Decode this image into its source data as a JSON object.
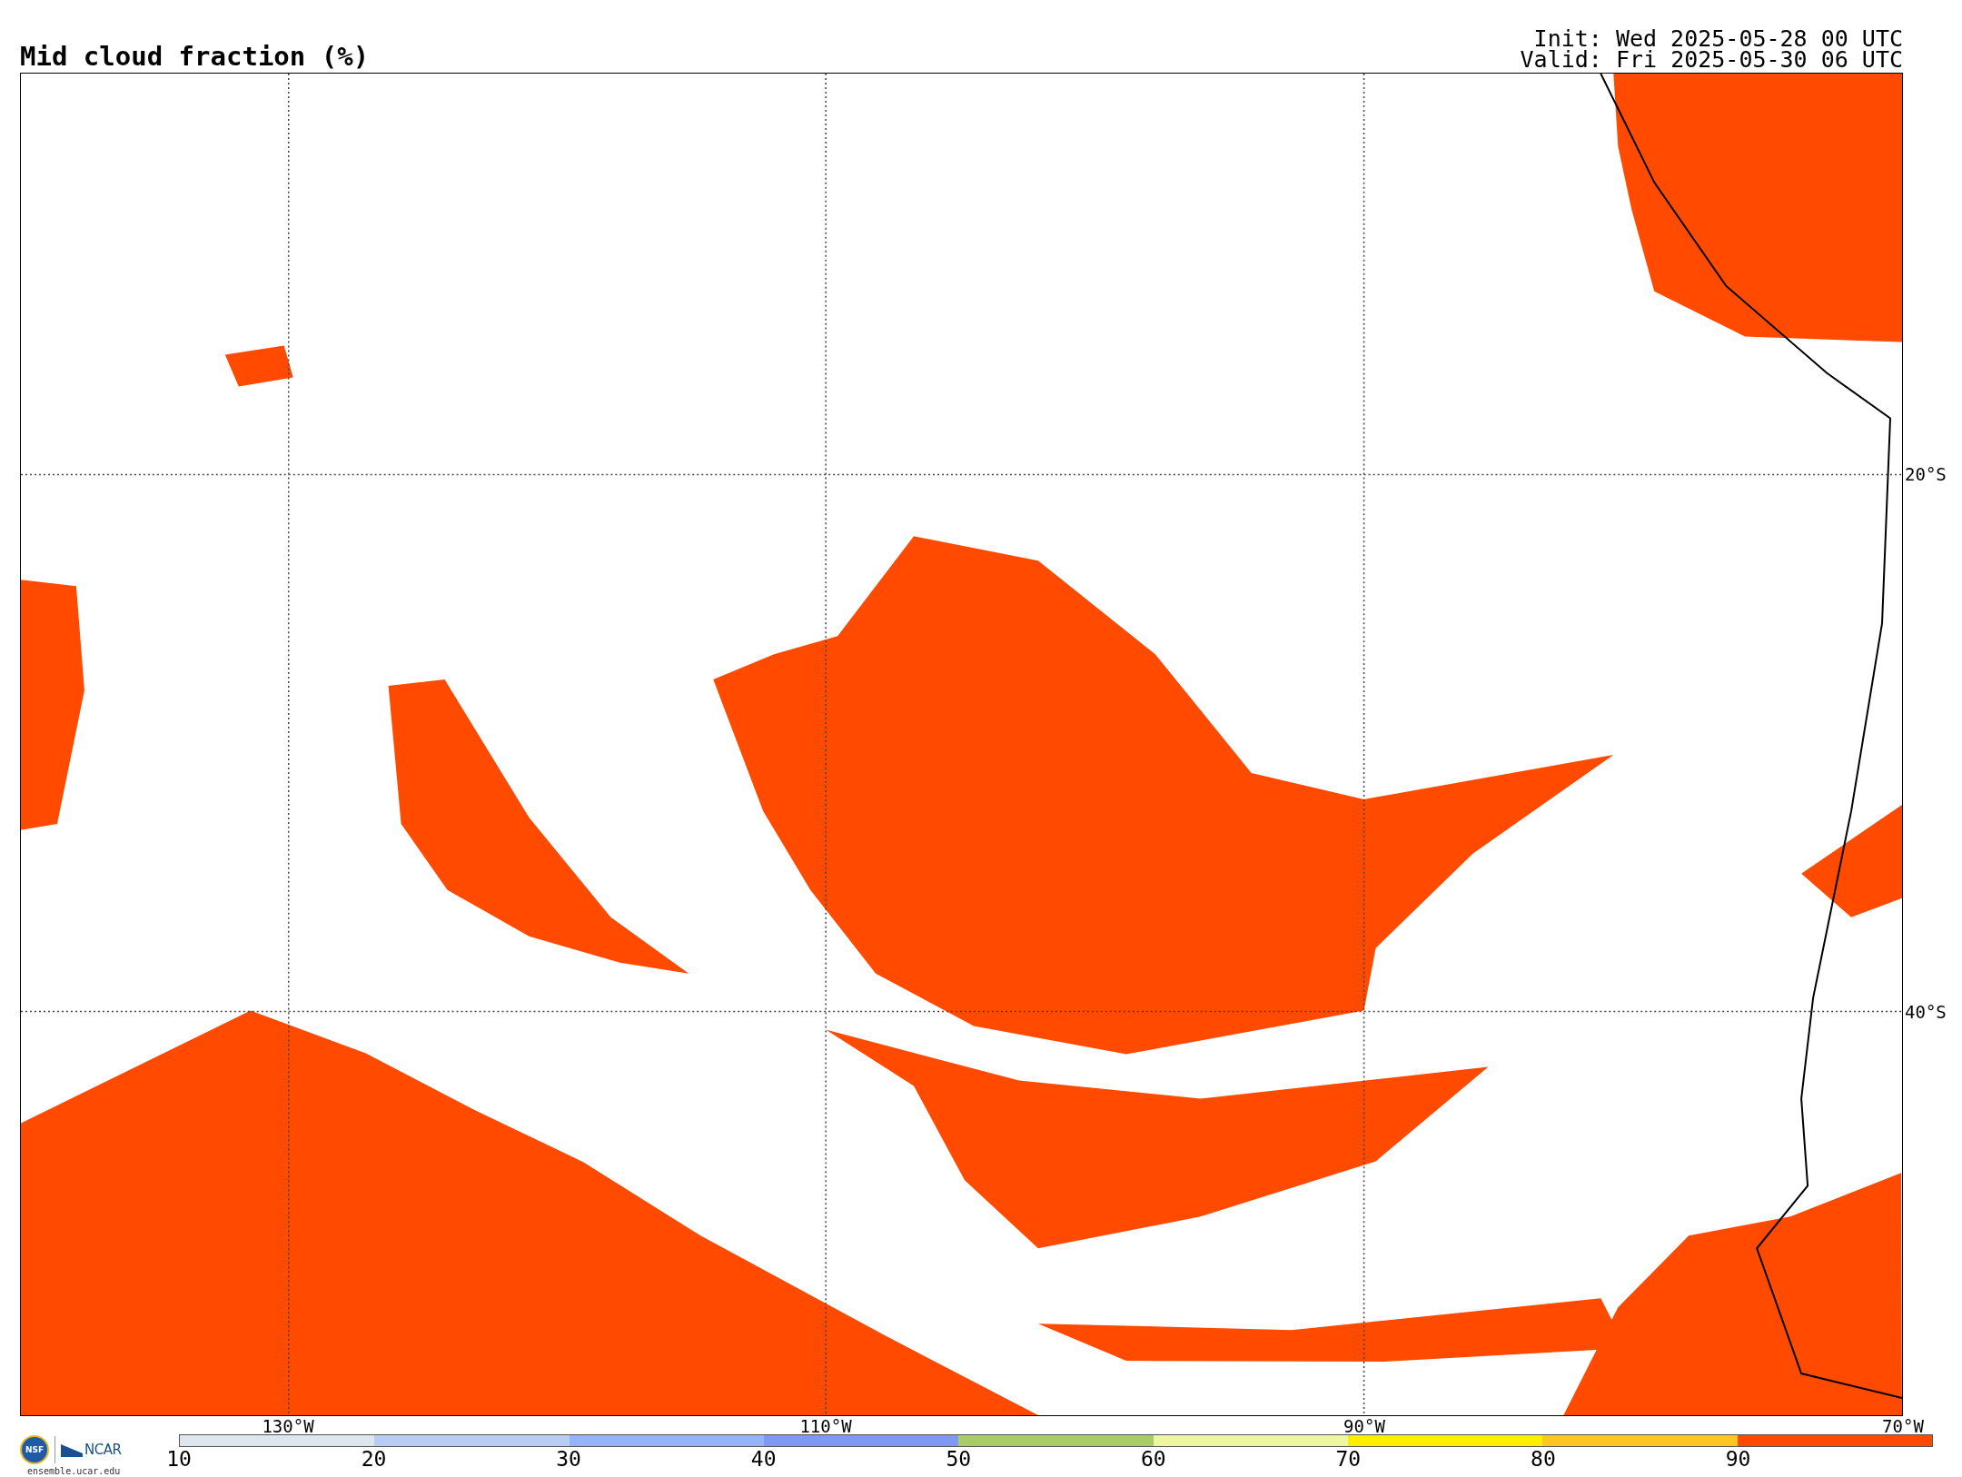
{
  "title": "Mid cloud fraction (%)",
  "init": "Init: Wed 2025-05-28 00 UTC",
  "valid": "Valid: Fri 2025-05-30 06 UTC",
  "map": {
    "lat_labels": [
      "20°S",
      "40°S"
    ],
    "lon_labels": [
      "130°W",
      "110°W",
      "90°W",
      "70°W"
    ]
  },
  "logos": {
    "nsf": "NSF",
    "ncar": "NCAR",
    "site": "ensemble.ucar.edu"
  },
  "colorbar": [
    {
      "label": "10",
      "color": "#dde6ef"
    },
    {
      "label": "20",
      "color": "#b8cdf6"
    },
    {
      "label": "30",
      "color": "#94b4fa"
    },
    {
      "label": "40",
      "color": "#7f98f4"
    },
    {
      "label": "50",
      "color": "#a8cc66"
    },
    {
      "label": "60",
      "color": "#eef6a0"
    },
    {
      "label": "70",
      "color": "#ffee00"
    },
    {
      "label": "80",
      "color": "#ffc520"
    },
    {
      "label": "90",
      "color": "#ff4a00"
    }
  ]
}
